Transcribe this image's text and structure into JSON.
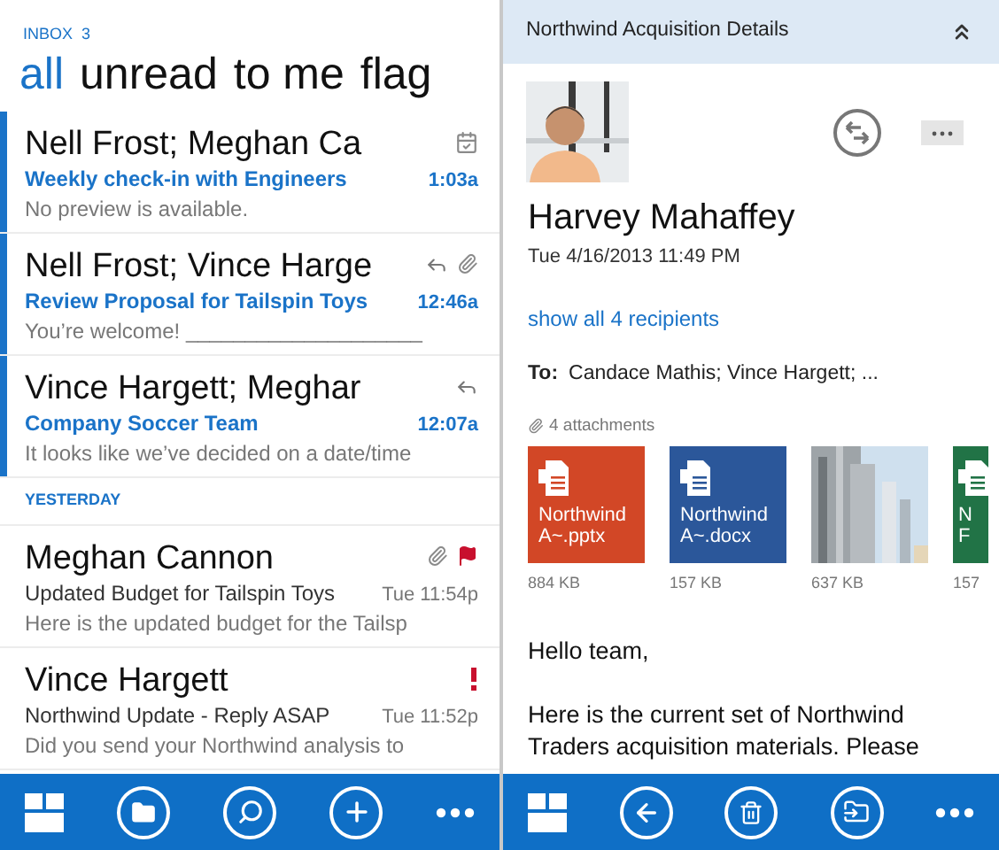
{
  "inbox": {
    "label": "INBOX",
    "count": "3"
  },
  "pivots": [
    {
      "label": "all",
      "selected": true
    },
    {
      "label": "unread",
      "selected": false
    },
    {
      "label": "to me",
      "selected": false
    },
    {
      "label": "flag",
      "selected": false
    }
  ],
  "groups": [
    {
      "messages": [
        {
          "sender": "Nell Frost; Meghan Ca",
          "subject": "Weekly check-in with Engineers",
          "preview": "No preview is available.",
          "time": "1:03a",
          "unread": true,
          "icons": [
            {
              "kind": "calendar"
            }
          ]
        },
        {
          "sender": "Nell Frost; Vince Harge",
          "subject": "Review Proposal for Tailspin Toys",
          "preview": "You’re welcome! ____________________",
          "time": "12:46a",
          "unread": true,
          "icons": [
            {
              "kind": "reply"
            },
            {
              "kind": "attachment"
            }
          ]
        },
        {
          "sender": "Vince Hargett; Meghar",
          "subject": "Company Soccer Team",
          "preview": "It looks like we’ve decided on a date/time",
          "time": "12:07a",
          "unread": true,
          "icons": [
            {
              "kind": "reply"
            }
          ]
        }
      ]
    },
    {
      "label": "YESTERDAY",
      "messages": [
        {
          "sender": "Meghan Cannon",
          "subject": "Updated Budget for Tailspin Toys",
          "preview": "Here is the updated budget for the Tailsp",
          "time": "Tue 11:54p",
          "unread": false,
          "icons": [
            {
              "kind": "attachment"
            },
            {
              "kind": "flag"
            }
          ]
        },
        {
          "sender": "Vince Hargett",
          "subject": "Northwind Update - Reply ASAP",
          "preview": "Did you send your Northwind analysis to",
          "time": "Tue 11:52p",
          "unread": false,
          "icons": [
            {
              "kind": "important"
            }
          ]
        }
      ]
    }
  ],
  "left_app_bar": [
    {
      "kind": "tiles"
    },
    {
      "kind": "folder"
    },
    {
      "kind": "search"
    },
    {
      "kind": "add"
    },
    {
      "kind": "more"
    }
  ],
  "detail": {
    "title": "Northwind Acquisition Details",
    "sender": "Harvey Mahaffey",
    "date": "Tue 4/16/2013 11:49 PM",
    "recipients_link": "show all 4 recipients",
    "to_label": "To:",
    "to": "Candace Mathis; Vince Hargett;  ...",
    "attachments_label": "4 attachments",
    "attachments": [
      {
        "kind": "pptx",
        "color": "#d24726",
        "lines": [
          "Northwind",
          "A~.pptx"
        ],
        "size": "884 KB"
      },
      {
        "kind": "docx",
        "color": "#2b579a",
        "lines": [
          "Northwind",
          "A~.docx"
        ],
        "size": "157 KB"
      },
      {
        "kind": "picture",
        "size": "637 KB"
      },
      {
        "kind": "xlsx",
        "color": "#217346",
        "lines": [
          "N",
          "F"
        ],
        "size": "157"
      }
    ],
    "body": [
      "Hello team,",
      "Here is the current set of Northwind Traders acquisition materials.  Please"
    ]
  },
  "right_app_bar": [
    {
      "kind": "tiles"
    },
    {
      "kind": "back"
    },
    {
      "kind": "delete"
    },
    {
      "kind": "move"
    },
    {
      "kind": "more"
    }
  ]
}
